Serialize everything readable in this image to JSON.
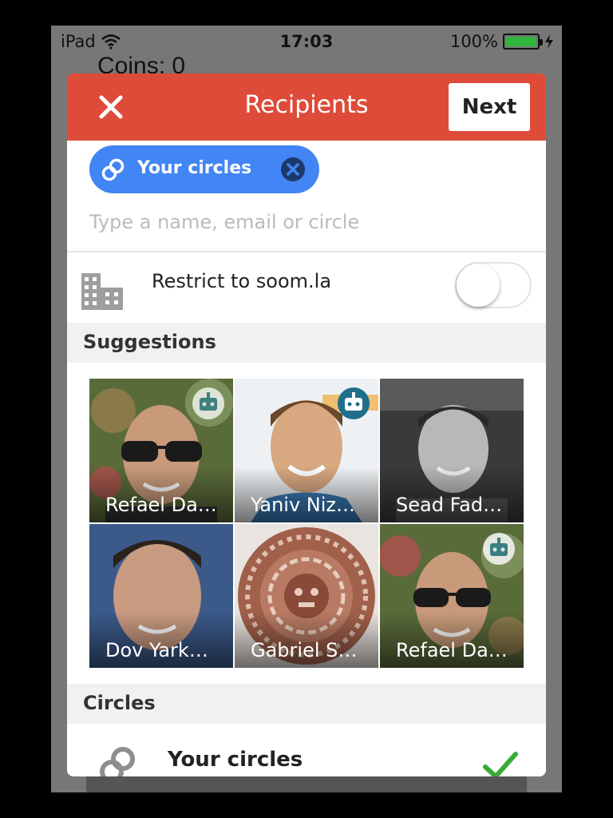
{
  "status_bar": {
    "device": "iPad",
    "time": "17:03",
    "battery": "100%"
  },
  "background": {
    "coins_label": "Coins: 0"
  },
  "dialog": {
    "title": "Recipients",
    "next_label": "Next",
    "chip_label": "Your circles",
    "input_placeholder": "Type a name, email or circle",
    "restrict_label": "Restrict to soom.la",
    "restrict_enabled": false,
    "suggestions_header": "Suggestions",
    "suggestions": [
      {
        "name": "Refael Da…",
        "badge": "robot-icon"
      },
      {
        "name": "Yaniv Niz…",
        "badge": "robot-icon"
      },
      {
        "name": "Sead Fad…",
        "badge": ""
      },
      {
        "name": "Dov Yark…",
        "badge": ""
      },
      {
        "name": "Gabriel S…",
        "badge": ""
      },
      {
        "name": "Refael Da…",
        "badge": "robot-icon"
      }
    ],
    "circles_header": "Circles",
    "circles": [
      {
        "name": "Your circles",
        "selected": true
      }
    ]
  },
  "colors": {
    "header": "#de4b39",
    "chip": "#4285f4",
    "check": "#3aaa35",
    "battery": "#2fb53a"
  }
}
